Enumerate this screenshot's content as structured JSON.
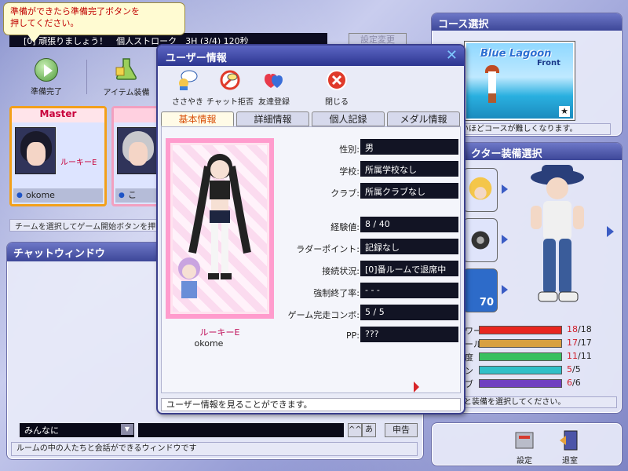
{
  "tooltip": {
    "line1": "準備ができたら準備完了ボタンを",
    "line2": "押してください。"
  },
  "room": {
    "status": "[0] 頑張りましょう！　個人ストローク　3H (3/4) 120秒",
    "settings_label": "設定変更"
  },
  "toolbar": {
    "ready_label": "準備完了",
    "item_label": "アイテム装備"
  },
  "team": {
    "slots": [
      {
        "title": "Master",
        "rank": "ルーキーE",
        "player": "okome"
      },
      {
        "title": "",
        "rank": "",
        "player": "こ"
      }
    ],
    "hint": "チームを選択してゲーム開始ボタンを押"
  },
  "chat": {
    "title": "チャットウィンドウ",
    "target": "みんなに",
    "mode_caret": "^^",
    "mode_kana": "あ",
    "send_label": "申告",
    "hint": "ルームの中の人たちと会話ができるウィンドウです"
  },
  "course": {
    "title": "コース選択",
    "name": "Blue Lagoon",
    "sub": "Front",
    "hint": "が多いほどコースが難しくなります。"
  },
  "character": {
    "title": "クター装備選択",
    "level_value": "70",
    "stats": [
      {
        "label": "ワー",
        "cur": "18",
        "max": "18",
        "fraction": 1.0,
        "color": "#e8261f"
      },
      {
        "label": "ール",
        "cur": "17",
        "max": "17",
        "fraction": 1.0,
        "color": "#d8a040"
      },
      {
        "label": "度",
        "cur": "11",
        "max": "11",
        "fraction": 1.0,
        "color": "#38c060"
      },
      {
        "label": "ン",
        "cur": "5",
        "max": "5",
        "fraction": 1.0,
        "color": "#30c0c8"
      },
      {
        "label": "ブ",
        "cur": "6",
        "max": "6",
        "fraction": 1.0,
        "color": "#7040c0"
      }
    ],
    "hint": "と装備を選択してください。"
  },
  "bottom_right": {
    "settings_label": "設定",
    "exit_label": "退室"
  },
  "modal": {
    "title": "ユーザー情報",
    "close_glyph": "✕",
    "tools": [
      {
        "label": "ささやき"
      },
      {
        "label": "チャット拒否"
      },
      {
        "label": "友達登録"
      },
      {
        "label": "閉じる"
      }
    ],
    "tabs": [
      "基本情報",
      "詳細情報",
      "個人記録",
      "メダル情報"
    ],
    "avatar_rank": "ルーキーE",
    "avatar_user": "okome",
    "fields": [
      {
        "label": "性別:",
        "value": "男"
      },
      {
        "label": "学校:",
        "value": "所属学校なし"
      },
      {
        "label": "クラブ:",
        "value": "所属クラブなし"
      },
      {
        "label": "経験値:",
        "value": "8 / 40"
      },
      {
        "label": "ラダーポイント:",
        "value": "記録なし"
      },
      {
        "label": "接続状況:",
        "value": "[0]番ルームで退席中"
      },
      {
        "label": "強制終了率:",
        "value": "- - -"
      },
      {
        "label": "ゲーム完走コンボ:",
        "value": "5 / 5"
      },
      {
        "label": "PP:",
        "value": "???"
      }
    ],
    "status": "ユーザー情報を見ることができます。"
  }
}
